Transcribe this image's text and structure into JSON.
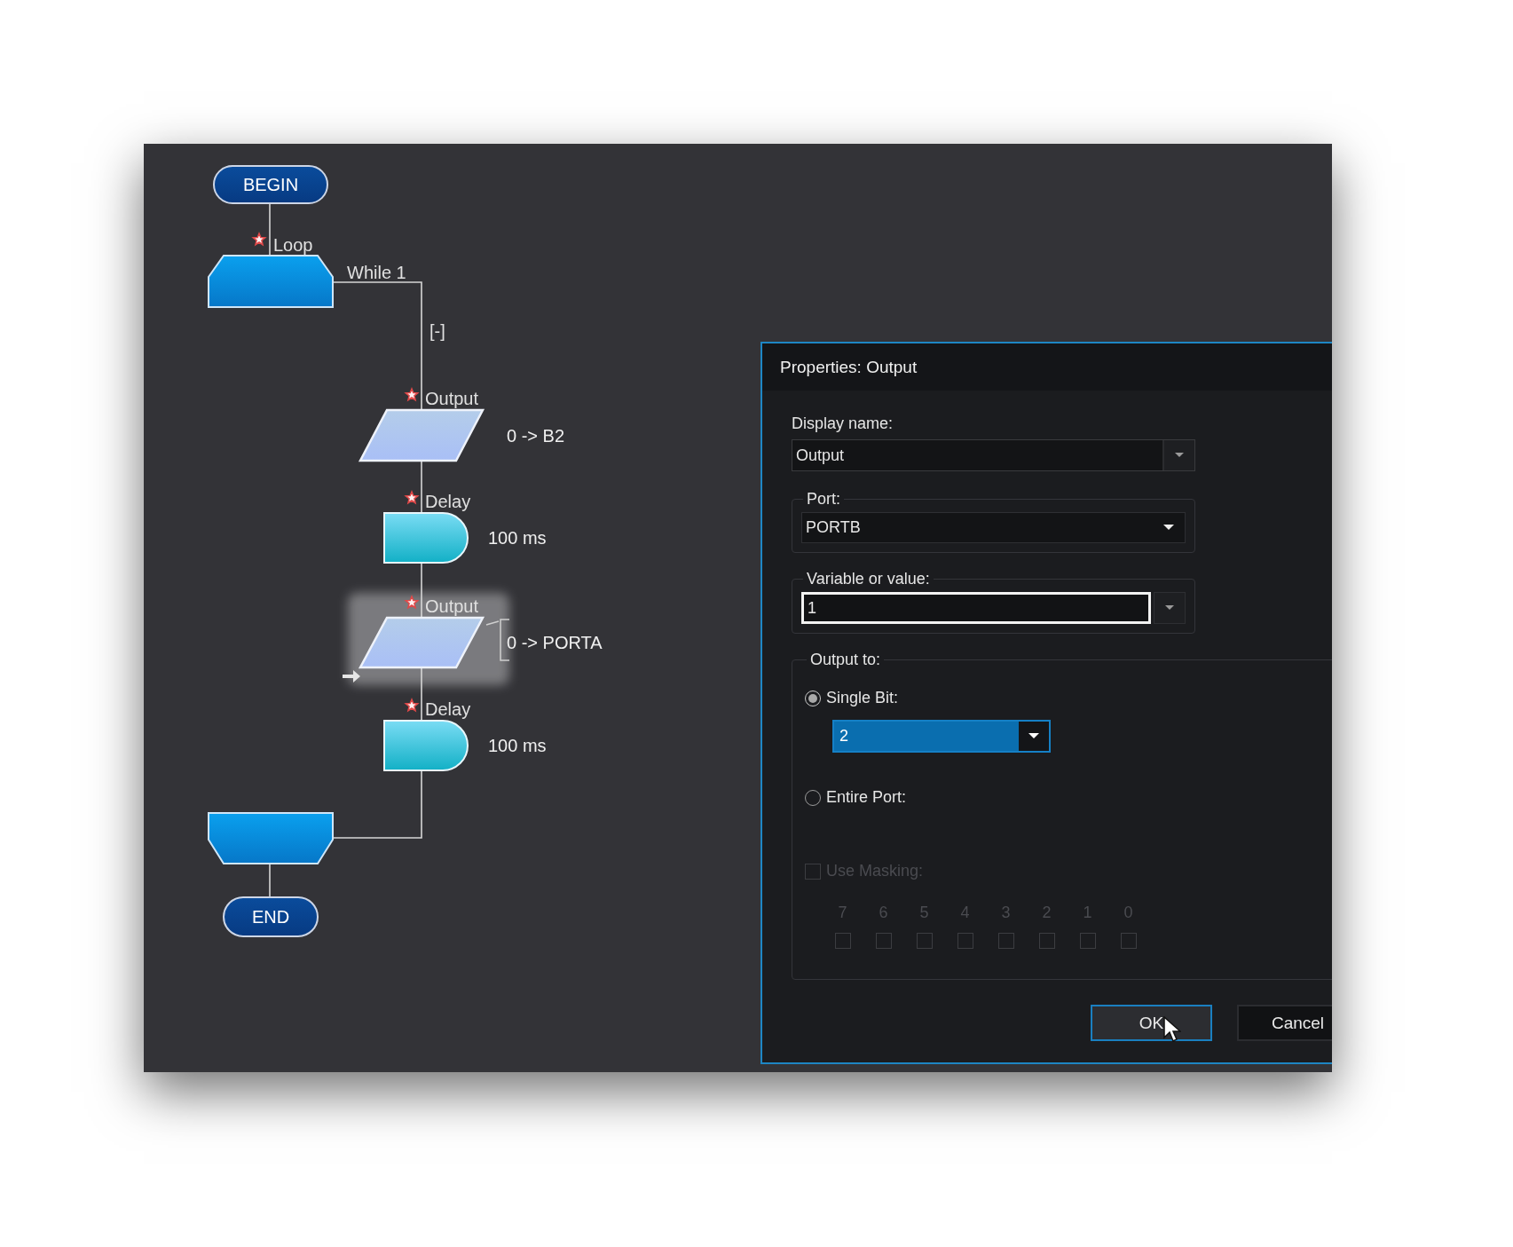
{
  "flowchart": {
    "nodes": [
      {
        "kind": "terminal",
        "label": "BEGIN"
      },
      {
        "kind": "loop_start",
        "label": "Loop",
        "condition": "While 1",
        "collapse": "[-]",
        "selected": false
      },
      {
        "kind": "output",
        "label": "Output",
        "detail": "0 -> B2",
        "selected": false
      },
      {
        "kind": "delay",
        "label": "Delay",
        "detail": "100 ms",
        "selected": false
      },
      {
        "kind": "output",
        "label": "Output",
        "detail": "0 -> PORTA",
        "selected": true
      },
      {
        "kind": "delay",
        "label": "Delay",
        "detail": "100 ms",
        "selected": false
      },
      {
        "kind": "loop_end",
        "selected": false
      },
      {
        "kind": "terminal",
        "label": "END"
      }
    ]
  },
  "dialog": {
    "title": "Properties: Output",
    "display_name": {
      "label": "Display name:",
      "value": "Output"
    },
    "port": {
      "label": "Port:",
      "value": "PORTB"
    },
    "variable": {
      "label": "Variable or value:",
      "value": "1",
      "focused": true
    },
    "output_to": {
      "label": "Output to:",
      "options": [
        {
          "label": "Single Bit:",
          "selected": true
        },
        {
          "label": "Entire Port:",
          "selected": false
        }
      ],
      "bit_select": {
        "value": "2"
      },
      "masking": {
        "label": "Use Masking:",
        "checked": false,
        "disabled": true
      },
      "bits": [
        {
          "label": "7",
          "checked": false
        },
        {
          "label": "6",
          "checked": false
        },
        {
          "label": "5",
          "checked": false
        },
        {
          "label": "4",
          "checked": false
        },
        {
          "label": "3",
          "checked": false
        },
        {
          "label": "2",
          "checked": false
        },
        {
          "label": "1",
          "checked": false
        },
        {
          "label": "0",
          "checked": false
        }
      ]
    },
    "buttons": [
      {
        "label": "OK",
        "focused": true
      },
      {
        "label": "Cancel",
        "focused": false
      }
    ]
  }
}
